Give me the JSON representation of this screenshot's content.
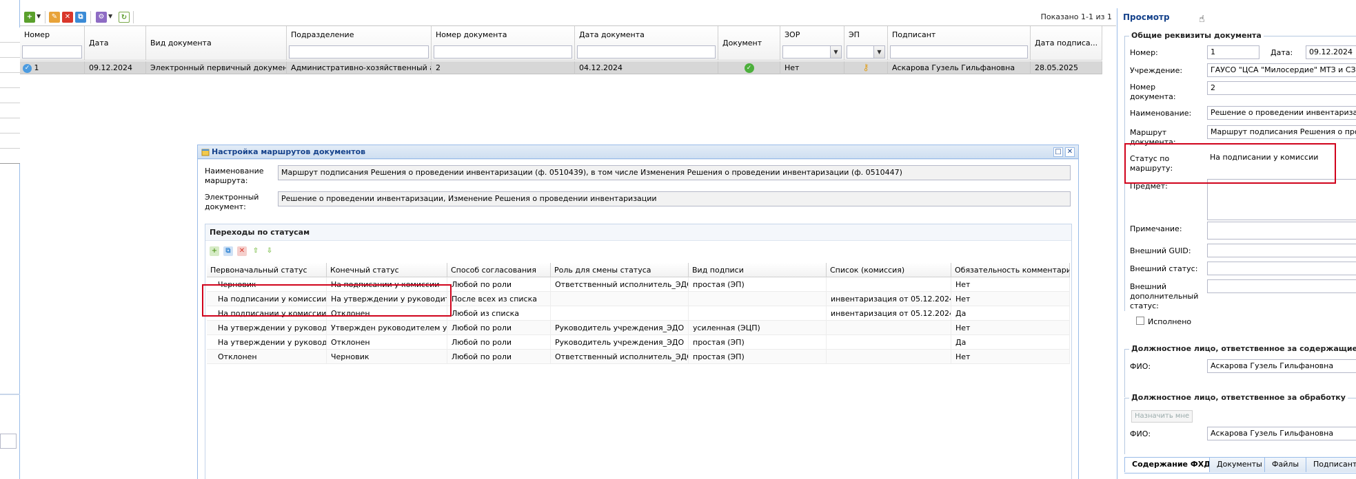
{
  "toolbar": {
    "shown_text": "Показано 1-1 из 1"
  },
  "grid": {
    "columns": [
      {
        "label": "Номер"
      },
      {
        "label": "Дата"
      },
      {
        "label": "Вид документа"
      },
      {
        "label": "Подразделение"
      },
      {
        "label": "Номер документа"
      },
      {
        "label": "Дата документа"
      },
      {
        "label": "Документ"
      },
      {
        "label": "ЗОР"
      },
      {
        "label": "ЭП"
      },
      {
        "label": "Подписант"
      },
      {
        "label": "Дата подписа..."
      }
    ],
    "row": {
      "number": "1",
      "date": "09.12.2024",
      "doc_type": "Электронный первичный документ",
      "department": "Административно-хозяйственный ап...",
      "doc_number": "2",
      "doc_date": "04.12.2024",
      "zor": "Нет",
      "signer": "Аскарова Гузель Гильфановна",
      "sign_date": "28.05.2025"
    }
  },
  "dialog": {
    "title": "Настройка маршрутов документов",
    "route_name_label": "Наименование маршрута:",
    "route_name_value": "Маршрут подписания Решения о проведении инвентаризации (ф. 0510439), в том числе Изменения Решения о проведении инвентаризации (ф. 0510447)",
    "edoc_label": "Электронный документ:",
    "edoc_value": "Решение о проведении инвентаризации, Изменение Решения о проведении инвентаризации",
    "transitions_title": "Переходы по статусам",
    "table_headers": [
      "Первоначальный статус",
      "Конечный статус",
      "Способ согласования",
      "Роль для смены статуса",
      "Вид подписи",
      "Список (комиссия)",
      "Обязательность комментария"
    ],
    "rows": [
      [
        "Черновик",
        "На подписании у комиссии",
        "Любой по роли",
        "Ответственный исполнитель_ЭДО",
        "простая (ЭП)",
        "",
        "Нет"
      ],
      [
        "На подписании у комиссии",
        "На утверждении у руководите...",
        "После всех из списка",
        "",
        "",
        "инвентаризация от 05.12.2024",
        "Нет"
      ],
      [
        "На подписании у комиссии",
        "Отклонен",
        "Любой из списка",
        "",
        "",
        "инвентаризация от 05.12.2024",
        "Да"
      ],
      [
        "На утверждении у руководи...",
        "Утвержден руководителем уч...",
        "Любой по роли",
        "Руководитель учреждения_ЭДО",
        "усиленная (ЭЦП)",
        "",
        "Нет"
      ],
      [
        "На утверждении у руководи...",
        "Отклонен",
        "Любой по роли",
        "Руководитель учреждения_ЭДО",
        "простая (ЭП)",
        "",
        "Да"
      ],
      [
        "Отклонен",
        "Черновик",
        "Любой по роли",
        "Ответственный исполнитель_ЭДО",
        "простая (ЭП)",
        "",
        "Нет"
      ]
    ]
  },
  "right_panel": {
    "title": "Просмотр",
    "general_section": "Общие реквизиты документа",
    "number_label": "Номер:",
    "number_value": "1",
    "date_label": "Дата:",
    "date_value": "09.12.2024",
    "institution_label": "Учреждение:",
    "institution_value": "ГАУСО \"ЦСА \"Милосердие\" МТЗ и СЗ РТ",
    "doc_number_label": "Номер документа:",
    "doc_number_value": "2",
    "name_label": "Наименование:",
    "name_value": "Решение о проведении инвентаризации",
    "route_label": "Маршрут документа:",
    "route_value": "Маршрут подписания Решения о прове",
    "status_label": "Статус по маршруту:",
    "status_value": "На подписании у комиссии",
    "subject_label": "Предмет:",
    "note_label": "Примечание:",
    "ext_guid_label": "Внешний GUID:",
    "ext_status_label": "Внешний статус:",
    "ext_add_status_label": "Внешний дополнительный статус:",
    "done_label": "Исполнено",
    "resp_content_section": "Должностное лицо, ответственное за содержащиеся в д",
    "fio_label": "ФИО:",
    "fio_value": "Аскарова Гузель Гильфановна",
    "resp_processing_section": "Должностное лицо, ответственное за обработку",
    "assign_me": "Назначить мне",
    "fio2_label": "ФИО:",
    "fio2_value": "Аскарова Гузель Гильфановна",
    "tabs": [
      "Содержание ФХД",
      "Документы",
      "Файлы",
      "Подписанты"
    ]
  }
}
